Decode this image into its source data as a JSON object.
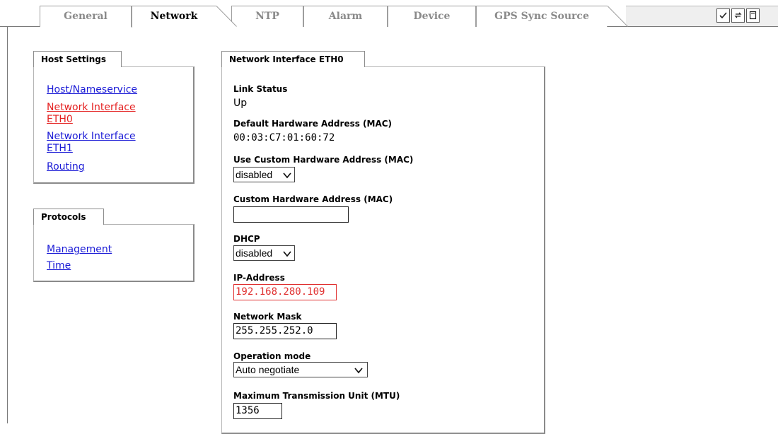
{
  "tabs": [
    {
      "label": "General",
      "active": false
    },
    {
      "label": "Network",
      "active": true
    },
    {
      "label": "NTP",
      "active": false
    },
    {
      "label": "Alarm",
      "active": false
    },
    {
      "label": "Device",
      "active": false
    },
    {
      "label": "GPS Sync Source",
      "active": false
    }
  ],
  "toolbar": {
    "icons": [
      "checkmark-icon",
      "reload-icon",
      "page-icon"
    ]
  },
  "host_settings": {
    "title": "Host Settings",
    "items": [
      {
        "label": "Host/Nameservice",
        "active": false
      },
      {
        "label": "Network Interface ETH0",
        "line1": "Network Interface",
        "line2": "ETH0",
        "active": true
      },
      {
        "label": "Network Interface ETH1",
        "line1": "Network Interface",
        "line2": "ETH1",
        "active": false
      },
      {
        "label": "Routing",
        "active": false
      }
    ]
  },
  "protocols": {
    "title": "Protocols",
    "items": [
      {
        "label": "Management"
      },
      {
        "label": "Time"
      }
    ]
  },
  "interface": {
    "title": "Network Interface ETH0",
    "link_status": {
      "label": "Link Status",
      "value": "Up"
    },
    "default_mac": {
      "label": "Default Hardware Address (MAC)",
      "value": "00:03:C7:01:60:72"
    },
    "use_custom_mac": {
      "label": "Use Custom Hardware Address (MAC)",
      "value": "disabled"
    },
    "custom_mac": {
      "label": "Custom Hardware Address (MAC)",
      "value": ""
    },
    "dhcp": {
      "label": "DHCP",
      "value": "disabled"
    },
    "ip_address": {
      "label": "IP-Address",
      "value": "192.168.280.109",
      "error_color": "#e03030"
    },
    "network_mask": {
      "label": "Network Mask",
      "value": "255.255.252.0"
    },
    "operation_mode": {
      "label": "Operation mode",
      "value": "Auto negotiate"
    },
    "mtu": {
      "label": "Maximum Transmission Unit (MTU)",
      "value": "1356"
    }
  },
  "colors": {
    "link": "#1a1ad6",
    "active_link": "#e41f1f",
    "inactive_tab_text": "#8a8a8a"
  }
}
